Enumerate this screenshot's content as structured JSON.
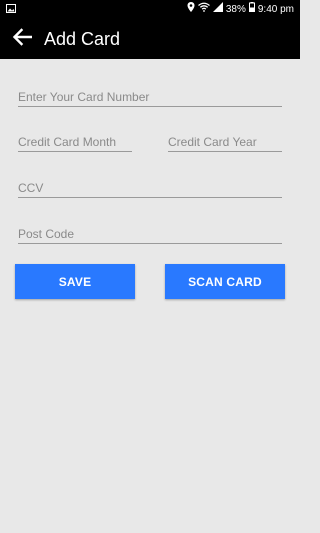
{
  "status_bar": {
    "battery": "38%",
    "time": "9:40 pm",
    "icons": [
      "image-icon",
      "location-icon",
      "wifi-icon",
      "signal-icon",
      "battery-icon"
    ]
  },
  "appbar": {
    "title": "Add Card",
    "back_icon": "arrow-back-icon"
  },
  "form": {
    "card_number": {
      "placeholder": "Enter Your Card Number",
      "value": ""
    },
    "card_month": {
      "placeholder": "Credit Card Month",
      "value": ""
    },
    "card_year": {
      "placeholder": "Credit Card Year",
      "value": ""
    },
    "ccv": {
      "placeholder": "CCV",
      "value": ""
    },
    "post_code": {
      "placeholder": "Post Code",
      "value": ""
    }
  },
  "buttons": {
    "save_label": "SAVE",
    "scan_label": "SCAN CARD"
  },
  "colors": {
    "bar": "#000000",
    "background": "#e8e8e8",
    "accent": "#2979ff"
  }
}
